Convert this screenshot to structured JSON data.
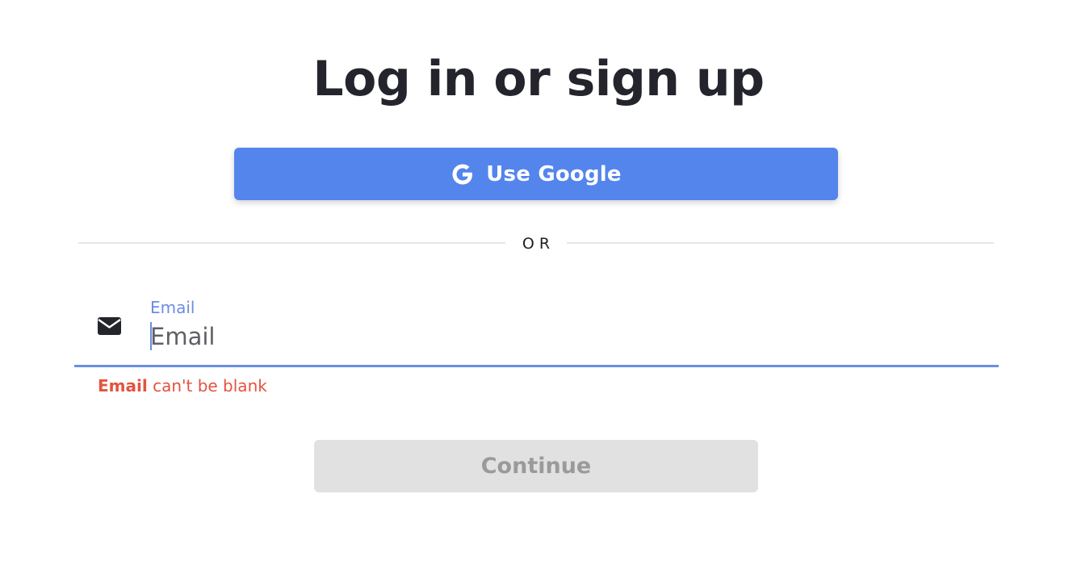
{
  "heading": "Log in or sign up",
  "google_button": {
    "icon": "google-icon",
    "label": "Use Google",
    "color": "#5485ec"
  },
  "divider": {
    "text": "OR"
  },
  "email_field": {
    "icon": "envelope-icon",
    "floating_label": "Email",
    "placeholder": "Email",
    "value": "",
    "accent_color": "#6c8de3"
  },
  "error": {
    "field": "Email",
    "message": " can't be blank",
    "color": "#e4533f"
  },
  "continue_button": {
    "label": "Continue",
    "disabled": true
  }
}
